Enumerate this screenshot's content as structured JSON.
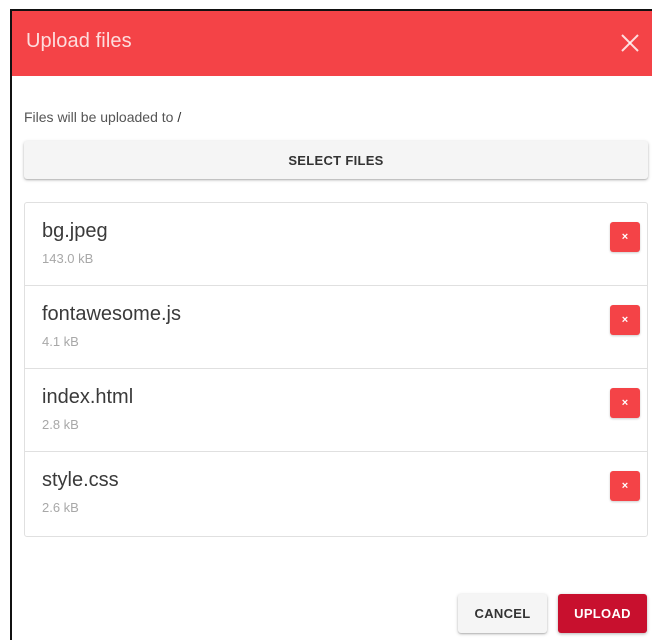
{
  "dialog": {
    "title": "Upload files",
    "close_icon": "close-icon",
    "destination_label": "Files will be uploaded to ",
    "destination_path": "/",
    "select_files_label": "SELECT FILES"
  },
  "files": [
    {
      "name": "bg.jpeg",
      "size": "143.0 kB",
      "remove_label": "×"
    },
    {
      "name": "fontawesome.js",
      "size": "4.1 kB",
      "remove_label": "×"
    },
    {
      "name": "index.html",
      "size": "2.8 kB",
      "remove_label": "×"
    },
    {
      "name": "style.css",
      "size": "2.6 kB",
      "remove_label": "×"
    }
  ],
  "actions": {
    "cancel_label": "CANCEL",
    "upload_label": "UPLOAD"
  },
  "colors": {
    "header": "#f44347",
    "remove_button": "#f44347",
    "upload_button": "#c8102e"
  }
}
